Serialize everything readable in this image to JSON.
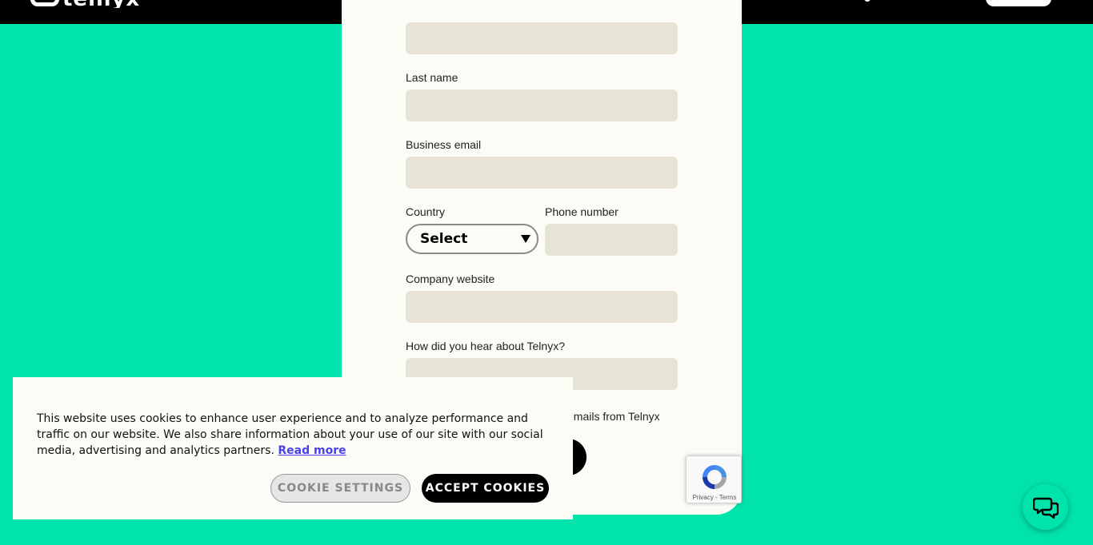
{
  "nav": {
    "logo_text": "telnyx"
  },
  "form": {
    "last_name_label": "Last name",
    "business_email_label": "Business email",
    "country_label": "Country",
    "country_value": "Select",
    "phone_label": "Phone number",
    "company_website_label": "Company website",
    "hear_about_label": "How did you hear about Telnyx?",
    "optin_text": "emails from Telnyx"
  },
  "recaptcha": {
    "links": "Privacy - Terms"
  },
  "cookie_banner": {
    "text": "This website uses cookies to enhance user experience and to analyze performance and traffic on our website. We also share information about your use of our site with our social media, advertising and analytics partners.",
    "read_more": "Read more",
    "settings_button": "COOKIE SETTINGS",
    "accept_button": "ACCEPT COOKIES"
  },
  "icons": {
    "chat": "chat-bubbles-icon",
    "select_arrow": "triangle-down-icon",
    "recaptcha": "recaptcha-icon"
  },
  "colors": {
    "background": "#00e3aa",
    "card": "#fcfcf6",
    "input": "#e7e3d6",
    "link": "#4b41e6"
  }
}
